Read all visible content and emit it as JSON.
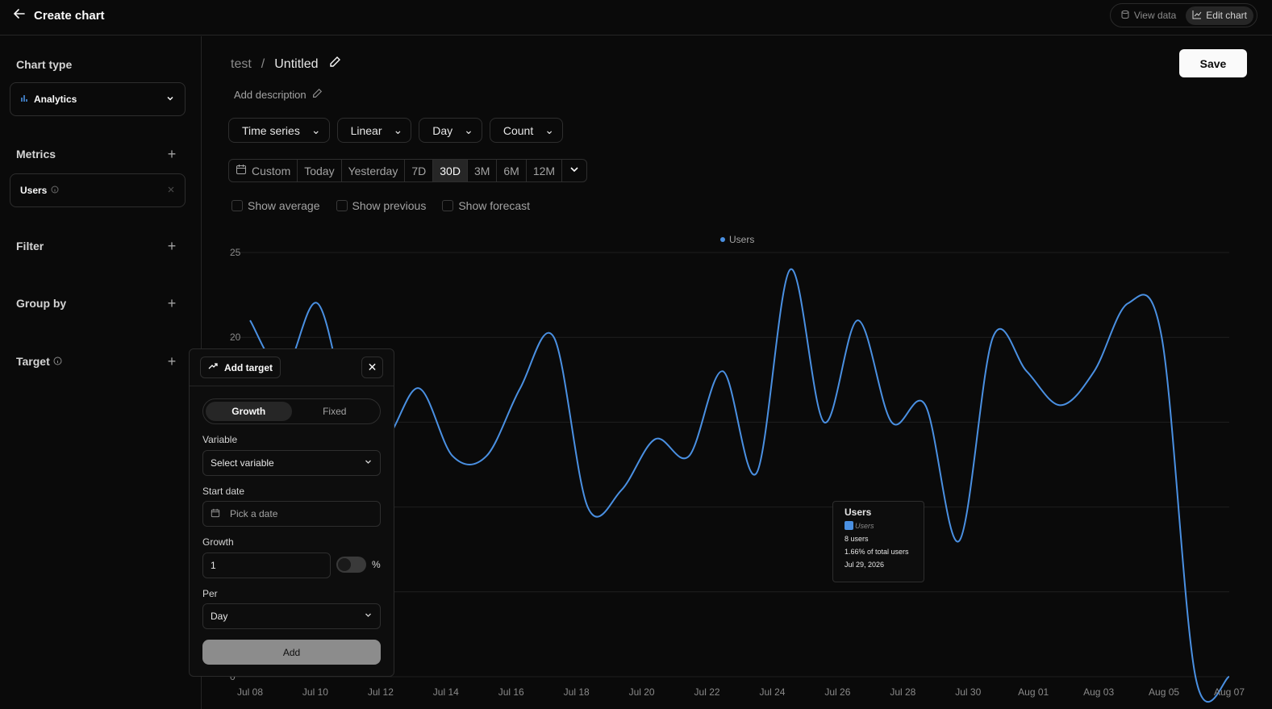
{
  "header": {
    "title": "Create chart",
    "view_data": "View data",
    "edit_chart": "Edit chart"
  },
  "sidebar": {
    "chart_type_title": "Chart type",
    "chart_type_value": "Analytics",
    "metrics_title": "Metrics",
    "metric_item": "Users",
    "filter_title": "Filter",
    "group_by_title": "Group by",
    "target_title": "Target"
  },
  "main": {
    "breadcrumb_project": "test",
    "breadcrumb_sep": "/",
    "chart_name": "Untitled",
    "description": "Add description",
    "save": "Save",
    "dropdowns": [
      "Time series",
      "Linear",
      "Day",
      "Count"
    ],
    "ranges": [
      "Custom",
      "Today",
      "Yesterday",
      "7D",
      "30D",
      "3M",
      "6M",
      "12M"
    ],
    "active_range": "30D",
    "checks": [
      "Show average",
      "Show previous",
      "Show forecast"
    ]
  },
  "tooltip": {
    "title": "Users",
    "series": "Users",
    "value": "8 users",
    "share": "1.66% of total users",
    "date": "Jul 29, 2026"
  },
  "target_panel": {
    "title": "Add target",
    "tabs": [
      "Growth",
      "Fixed"
    ],
    "active_tab": "Growth",
    "variable_label": "Variable",
    "variable_placeholder": "Select variable",
    "start_label": "Start date",
    "start_placeholder": "Pick a date",
    "growth_label": "Growth",
    "growth_value": "1",
    "percent": "%",
    "per_label": "Per",
    "per_value": "Day",
    "add_button": "Add"
  },
  "chart_data": {
    "type": "line",
    "legend": [
      "Users"
    ],
    "series": [
      {
        "name": "Users",
        "color": "#4a90e2",
        "values": [
          21,
          18,
          22,
          15,
          14,
          17,
          13,
          13,
          17,
          20,
          10,
          11,
          14,
          13,
          18,
          12,
          24,
          15,
          21,
          15,
          16,
          8,
          20,
          18,
          16,
          18,
          22,
          20,
          0,
          0
        ]
      }
    ],
    "x": [
      "Jul 08",
      "Jul 09",
      "Jul 10",
      "Jul 11",
      "Jul 12",
      "Jul 13",
      "Jul 14",
      "Jul 15",
      "Jul 16",
      "Jul 17",
      "Jul 18",
      "Jul 19",
      "Jul 20",
      "Jul 21",
      "Jul 22",
      "Jul 23",
      "Jul 24",
      "Jul 25",
      "Jul 26",
      "Jul 27",
      "Jul 28",
      "Jul 29",
      "Jul 30",
      "Jul 31",
      "Aug 01",
      "Aug 02",
      "Aug 03",
      "Aug 04",
      "Aug 05",
      "Aug 07"
    ],
    "x_tick_labels": [
      "Jul 08",
      "Jul 10",
      "Jul 12",
      "Jul 14",
      "Jul 16",
      "Jul 18",
      "Jul 20",
      "Jul 22",
      "Jul 24",
      "Jul 26",
      "Jul 28",
      "Jul 30",
      "Aug 01",
      "Aug 03",
      "Aug 05",
      "Aug 07"
    ],
    "y_tick_labels": [
      "25",
      "20",
      "0"
    ],
    "ylim": [
      0,
      25
    ],
    "grid": true
  }
}
